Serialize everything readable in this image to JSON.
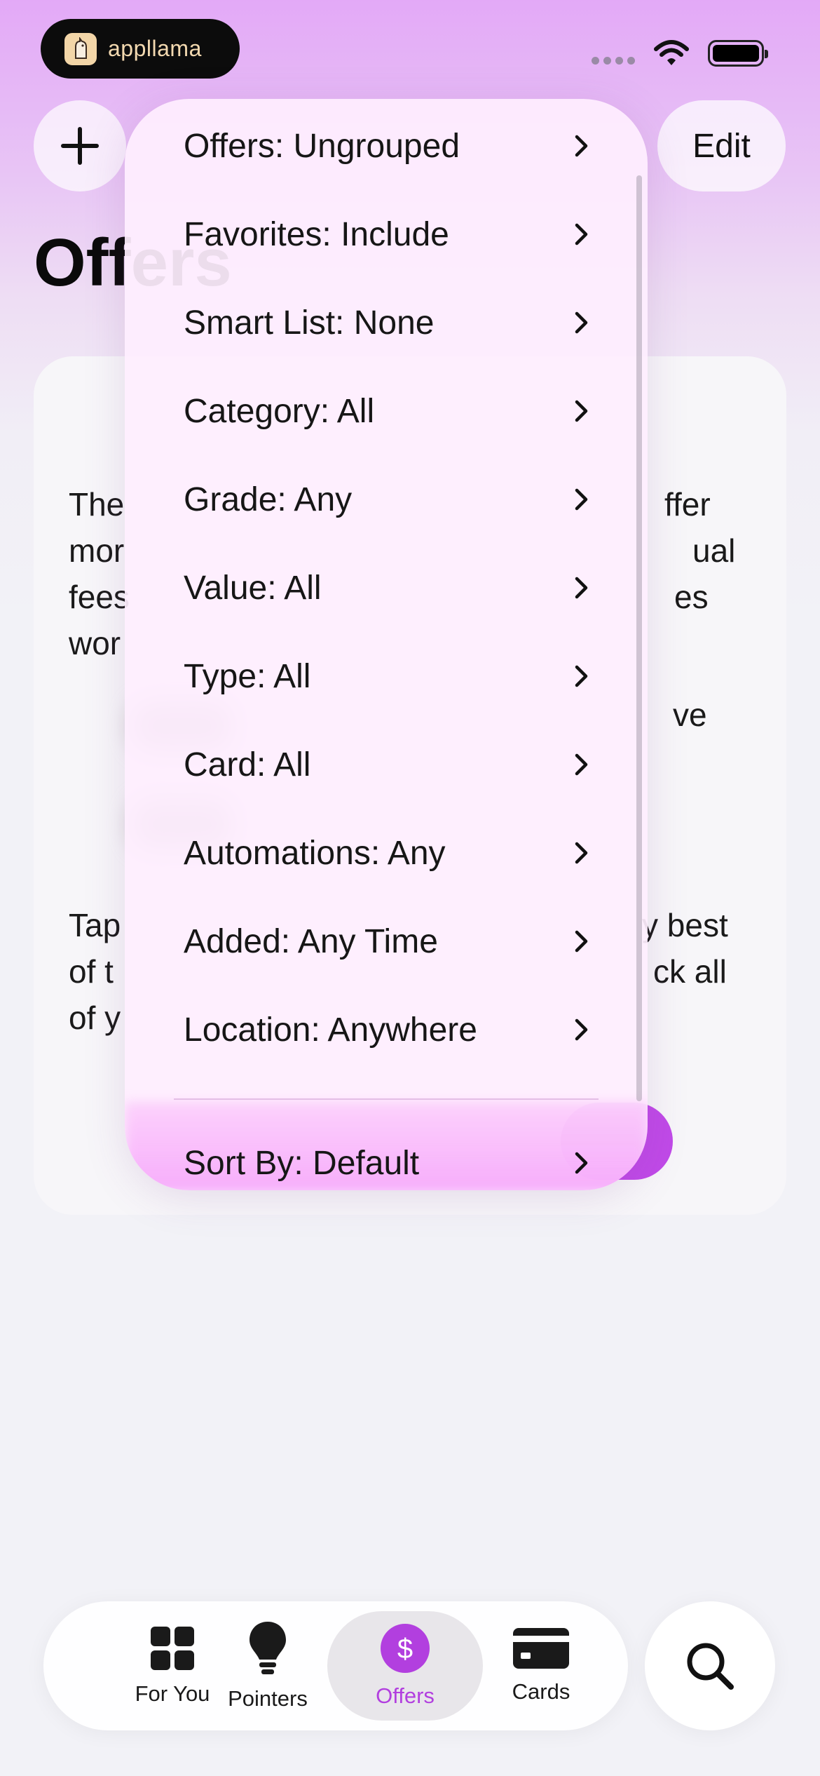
{
  "status_bar": {
    "brand_text": "appllama"
  },
  "header": {
    "edit_label": "Edit",
    "title": "Offers"
  },
  "background_card": {
    "line1_start": "The",
    "line1_end": "ffer",
    "line2_start": "mor",
    "line2_end": "ual",
    "line3_start": "fees",
    "line3_end": "es",
    "line4_start": "wor",
    "row_end": "ve",
    "line5_start": "Tap",
    "line5_end": "y best",
    "line6_start": "of t",
    "line6_end": "ck all",
    "line7_start": "of y"
  },
  "menu": {
    "items": [
      {
        "label": "Offers: Ungrouped"
      },
      {
        "label": "Favorites: Include"
      },
      {
        "label": "Smart List: None"
      },
      {
        "label": "Category: All"
      },
      {
        "label": "Grade: Any"
      },
      {
        "label": "Value: All"
      },
      {
        "label": "Type: All"
      },
      {
        "label": "Card: All"
      },
      {
        "label": "Automations: Any"
      },
      {
        "label": "Added: Any Time"
      },
      {
        "label": "Location: Anywhere"
      }
    ],
    "sort_label": "Sort By: Default"
  },
  "tabbar": {
    "tabs": [
      {
        "label": "For You",
        "icon": "grid-icon"
      },
      {
        "label": "Pointers",
        "icon": "lightbulb-icon"
      },
      {
        "label": "Offers",
        "icon": "dollar-circle-icon"
      },
      {
        "label": "Cards",
        "icon": "credit-card-icon"
      }
    ],
    "active_tab": "Offers"
  },
  "colors": {
    "accent": "#b23fdf",
    "accent_button": "#c04ae8",
    "menu_bg": "#feeefe"
  }
}
